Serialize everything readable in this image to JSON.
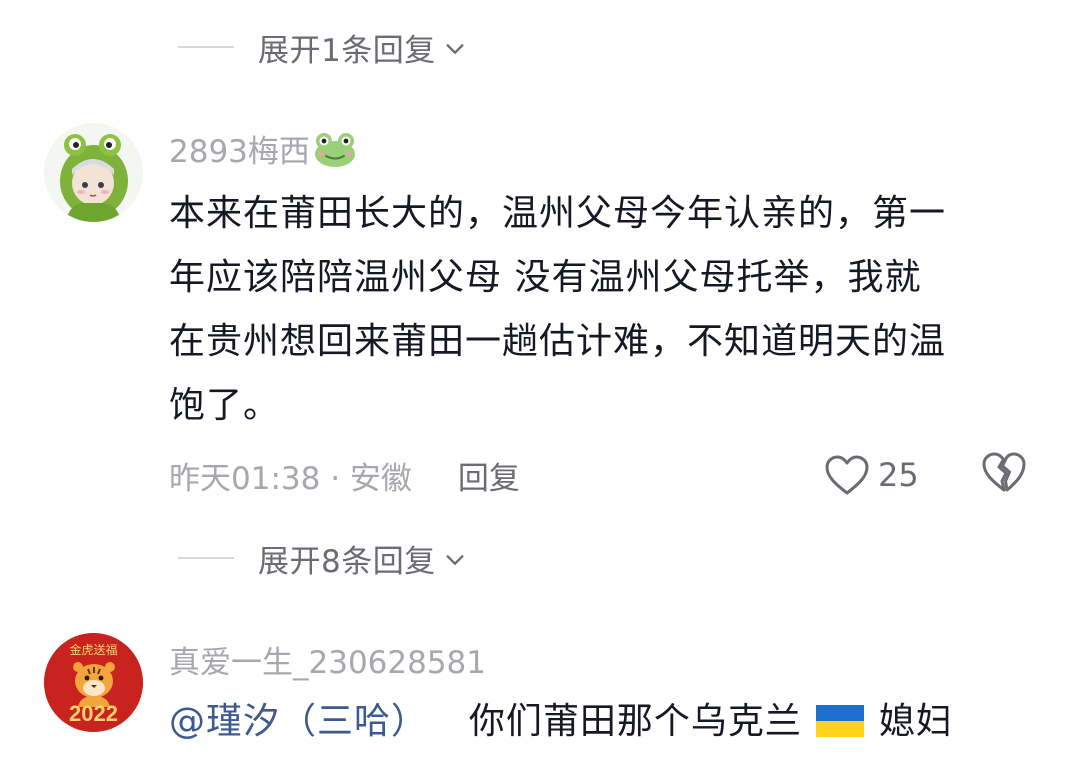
{
  "expand_top": {
    "label": "展开1条回复"
  },
  "comment1": {
    "username": "2893梅西",
    "username_emoji": "frog-face-icon",
    "lines": [
      "本来在莆田长大的，温州父母今年认亲的，第一",
      "年应该陪陪温州父母 没有温州父母托举，我就",
      "在贵州想回来莆田一趟估计难，不知道明天的温",
      "饱了。"
    ],
    "time_location": "昨天01:38 · 安徽",
    "reply_label": "回复",
    "like_count": "25"
  },
  "expand_mid": {
    "label": "展开8条回复"
  },
  "comment2": {
    "username": "真爱一生_230628581",
    "avatar_text": "2022",
    "avatar_top_text": "金虎送福",
    "mention": "@瑾汐（三哈）",
    "text_before_flag": "你们莆田那个乌克兰",
    "text_after_flag": "媳妇",
    "flag": "ukraine-flag-icon"
  },
  "colors": {
    "text_primary": "#161823",
    "text_secondary": "#a7a8ad",
    "link": "#3c5a8e",
    "divider": "#d9d9dc"
  }
}
